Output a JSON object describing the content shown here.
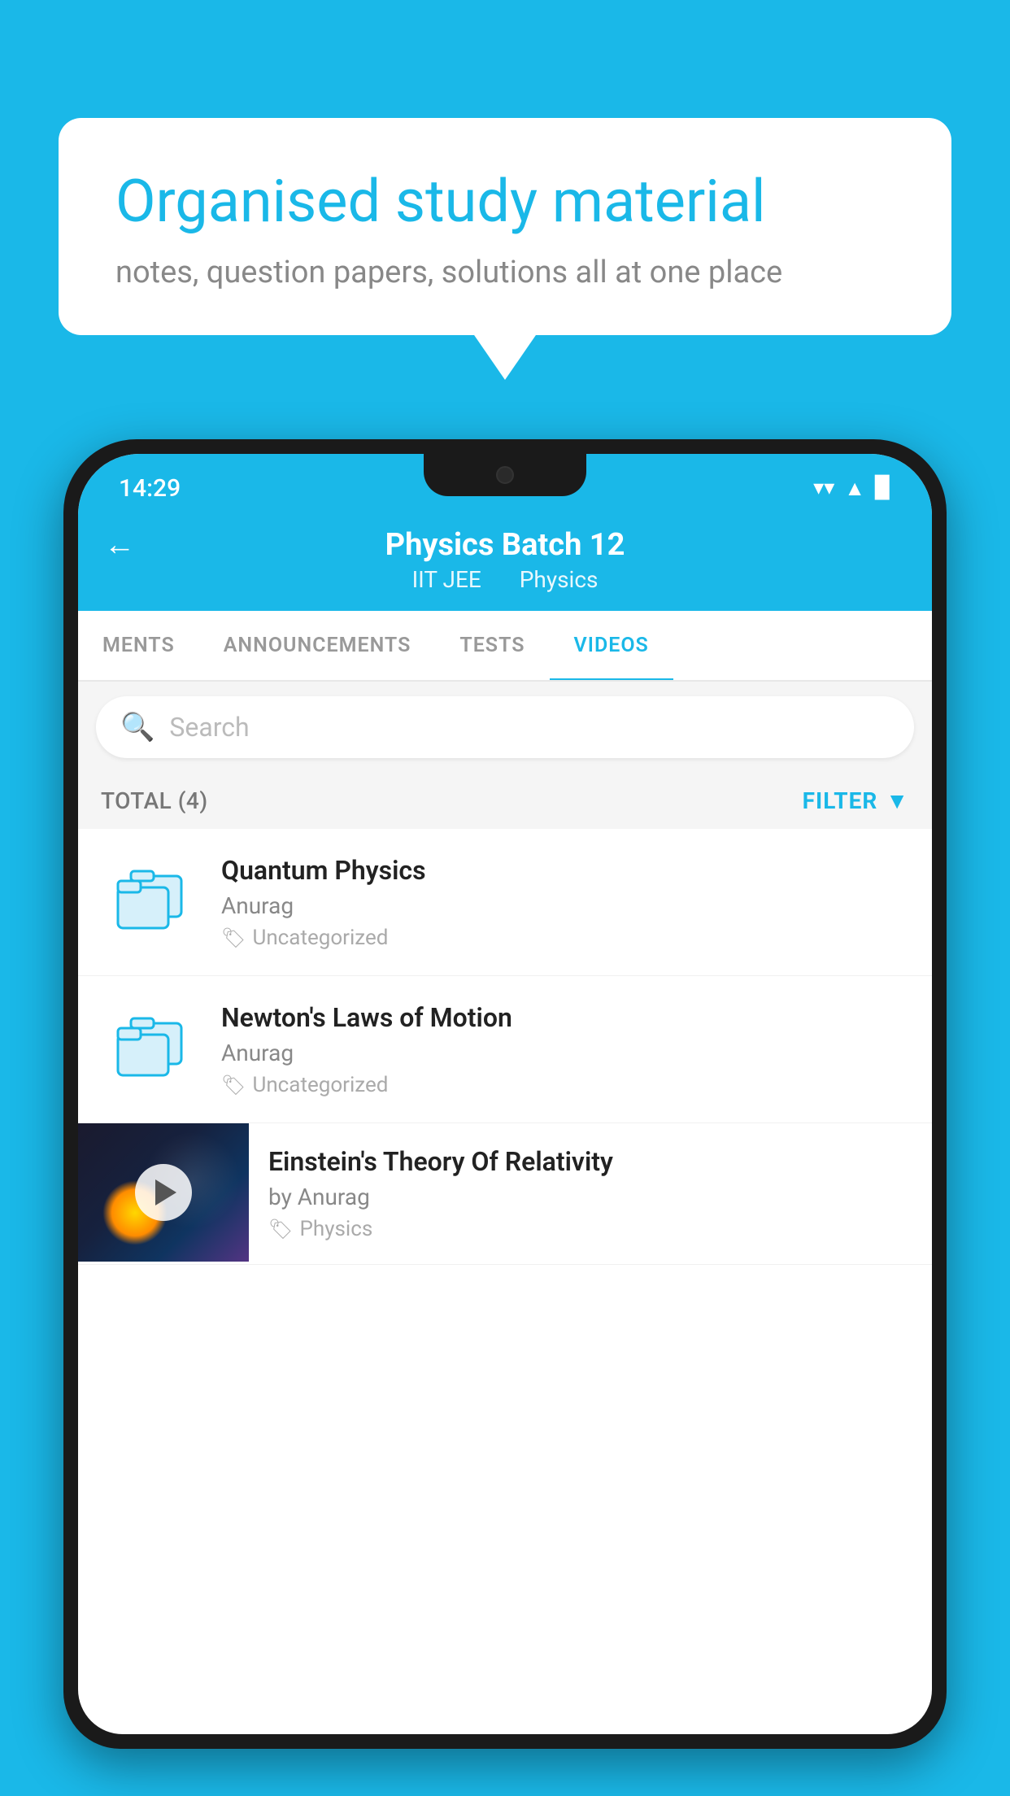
{
  "background": {
    "color": "#1ab8e8"
  },
  "speech_bubble": {
    "title": "Organised study material",
    "subtitle": "notes, question papers, solutions all at one place"
  },
  "status_bar": {
    "time": "14:29",
    "wifi": "▼",
    "signal": "▲",
    "battery": "▉"
  },
  "app_bar": {
    "back_label": "←",
    "title": "Physics Batch 12",
    "subtitle_part1": "IIT JEE",
    "subtitle_part2": "Physics"
  },
  "tabs": [
    {
      "label": "MENTS",
      "active": false
    },
    {
      "label": "ANNOUNCEMENTS",
      "active": false
    },
    {
      "label": "TESTS",
      "active": false
    },
    {
      "label": "VIDEOS",
      "active": true
    }
  ],
  "search": {
    "placeholder": "Search"
  },
  "total_filter": {
    "total_label": "TOTAL (4)",
    "filter_label": "FILTER"
  },
  "videos": [
    {
      "id": 1,
      "title": "Quantum Physics",
      "author": "Anurag",
      "tag": "Uncategorized",
      "has_thumbnail": false
    },
    {
      "id": 2,
      "title": "Newton's Laws of Motion",
      "author": "Anurag",
      "tag": "Uncategorized",
      "has_thumbnail": false
    },
    {
      "id": 3,
      "title": "Einstein's Theory Of Relativity",
      "author": "by Anurag",
      "tag": "Physics",
      "has_thumbnail": true
    }
  ]
}
